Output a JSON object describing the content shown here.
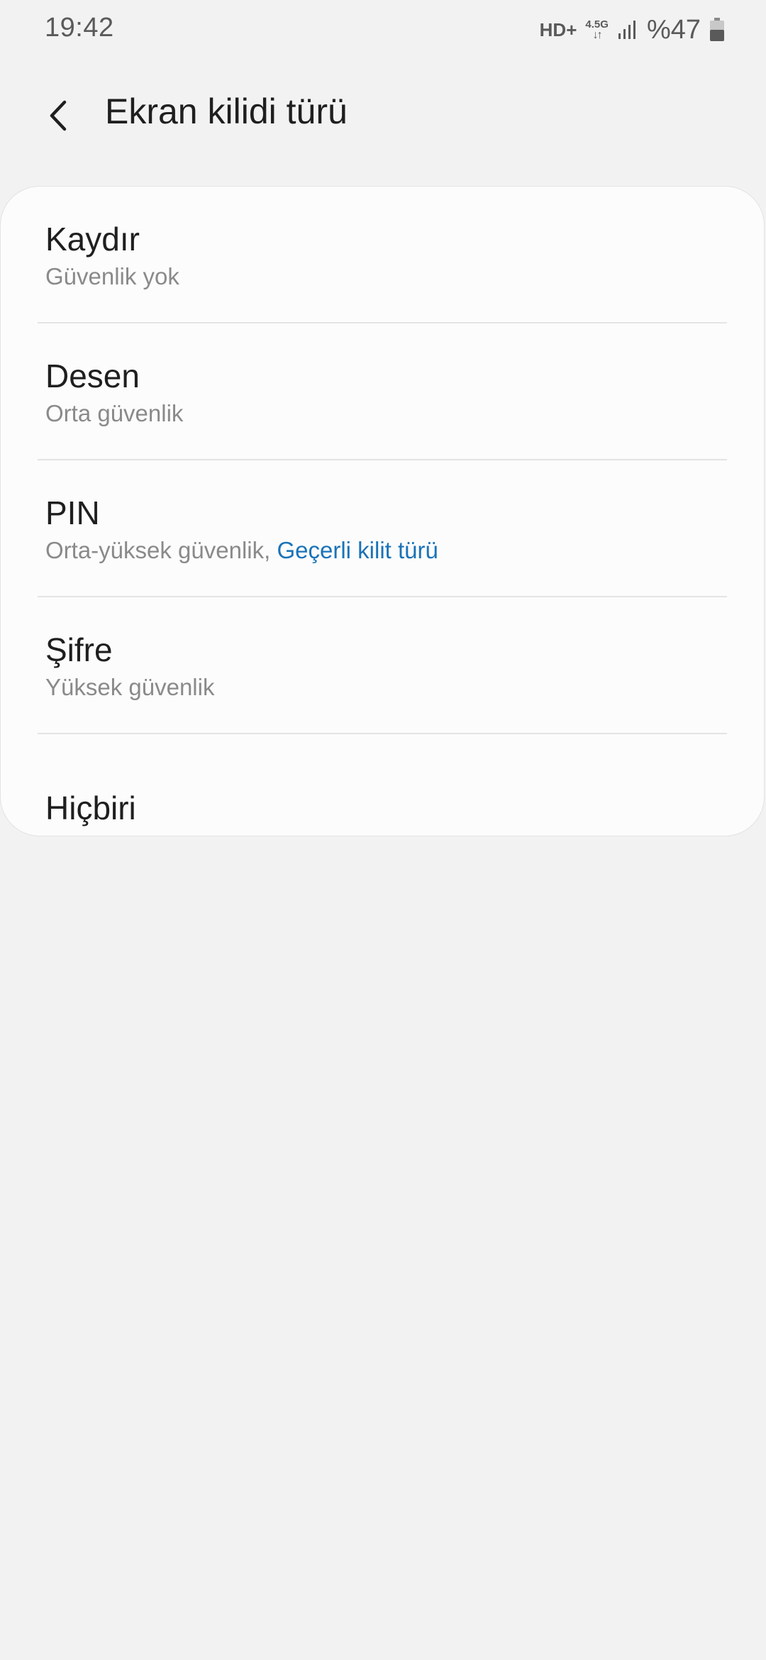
{
  "status_bar": {
    "time": "19:42",
    "hd_label": "HD+",
    "network_label": "4.5G",
    "network_arrows": "↓↑",
    "battery_text": "%47"
  },
  "header": {
    "title": "Ekran kilidi türü"
  },
  "options": [
    {
      "title": "Kaydır",
      "subtitle": "Güvenlik yok"
    },
    {
      "title": "Desen",
      "subtitle": "Orta güvenlik"
    },
    {
      "title": "PIN",
      "subtitle": "Orta-yüksek güvenlik, ",
      "current_label": "Geçerli kilit türü"
    },
    {
      "title": "Şifre",
      "subtitle": "Yüksek güvenlik"
    },
    {
      "title": "Hiçbiri"
    }
  ],
  "colors": {
    "accent": "#1a73b8",
    "background": "#f2f2f2",
    "card": "#fcfcfc"
  }
}
